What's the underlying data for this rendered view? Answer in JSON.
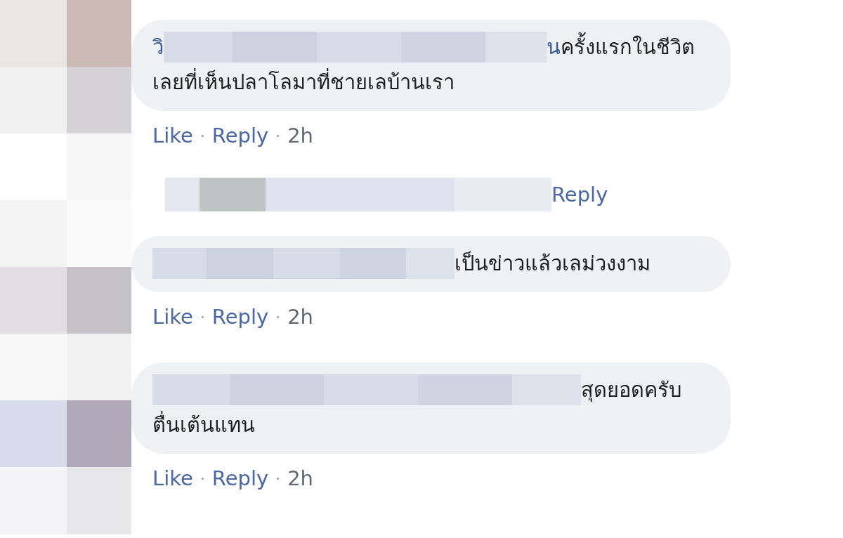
{
  "comments": [
    {
      "kind": "comment",
      "author_start": "วิ",
      "author_end": "น",
      "lines": [
        "ครั้งแรกในชีวิต",
        "เลยที่เห็นปลาโลมาที่ชายเลบ้านเรา"
      ],
      "actions": [
        "Like",
        "Reply"
      ],
      "time": "2h"
    },
    {
      "kind": "replies",
      "link": "Reply"
    },
    {
      "kind": "comment",
      "lines": [
        "เป็นข่าวแล้วเลม่วงงาม"
      ],
      "actions": [
        "Like",
        "Reply"
      ],
      "time": "2h"
    },
    {
      "kind": "comment",
      "lines": [
        "สุดยอดครับ",
        "ตื่นเต้นแทน"
      ],
      "actions": [
        "Like",
        "Reply"
      ],
      "time": "2h"
    }
  ]
}
